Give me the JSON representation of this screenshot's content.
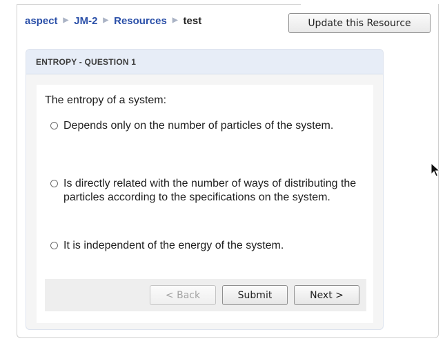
{
  "breadcrumb": {
    "items": [
      {
        "label": "aspect"
      },
      {
        "label": "JM-2"
      },
      {
        "label": "Resources"
      }
    ],
    "current": "test",
    "separator": "▶"
  },
  "toolbar": {
    "update_label": "Update this Resource"
  },
  "question": {
    "header": "ENTROPY - QUESTION 1",
    "prompt": "The entropy of a system:",
    "options": [
      {
        "label": "Depends only on the number of particles of the system.",
        "selected": false
      },
      {
        "label": "Is directly related with the number of ways of distributing the particles according to the specifications on the system.",
        "selected": false
      },
      {
        "label": "It is independent of the energy of the system.",
        "selected": false
      }
    ]
  },
  "navigation": {
    "back_label": "< Back",
    "back_enabled": false,
    "submit_label": "Submit",
    "next_label": "Next >"
  },
  "colors": {
    "link": "#2a4fa8",
    "header_bg": "#e7edf7"
  },
  "icons": {
    "cursor": "mouse-pointer-icon"
  }
}
